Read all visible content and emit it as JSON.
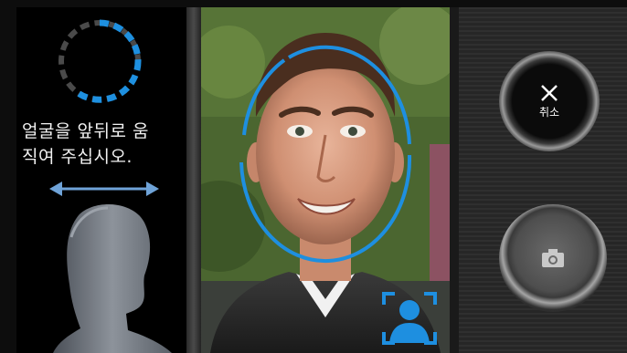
{
  "instruction": {
    "line1": "얼굴을 앞뒤로 움",
    "line2": "직여 주십시오."
  },
  "controls": {
    "cancel_label": "취소",
    "cancel_icon": "close-icon",
    "shutter_icon": "camera-icon"
  },
  "colors": {
    "accent": "#1e90e0",
    "panel_bg": "#000000",
    "text": "#f2f2f2"
  }
}
